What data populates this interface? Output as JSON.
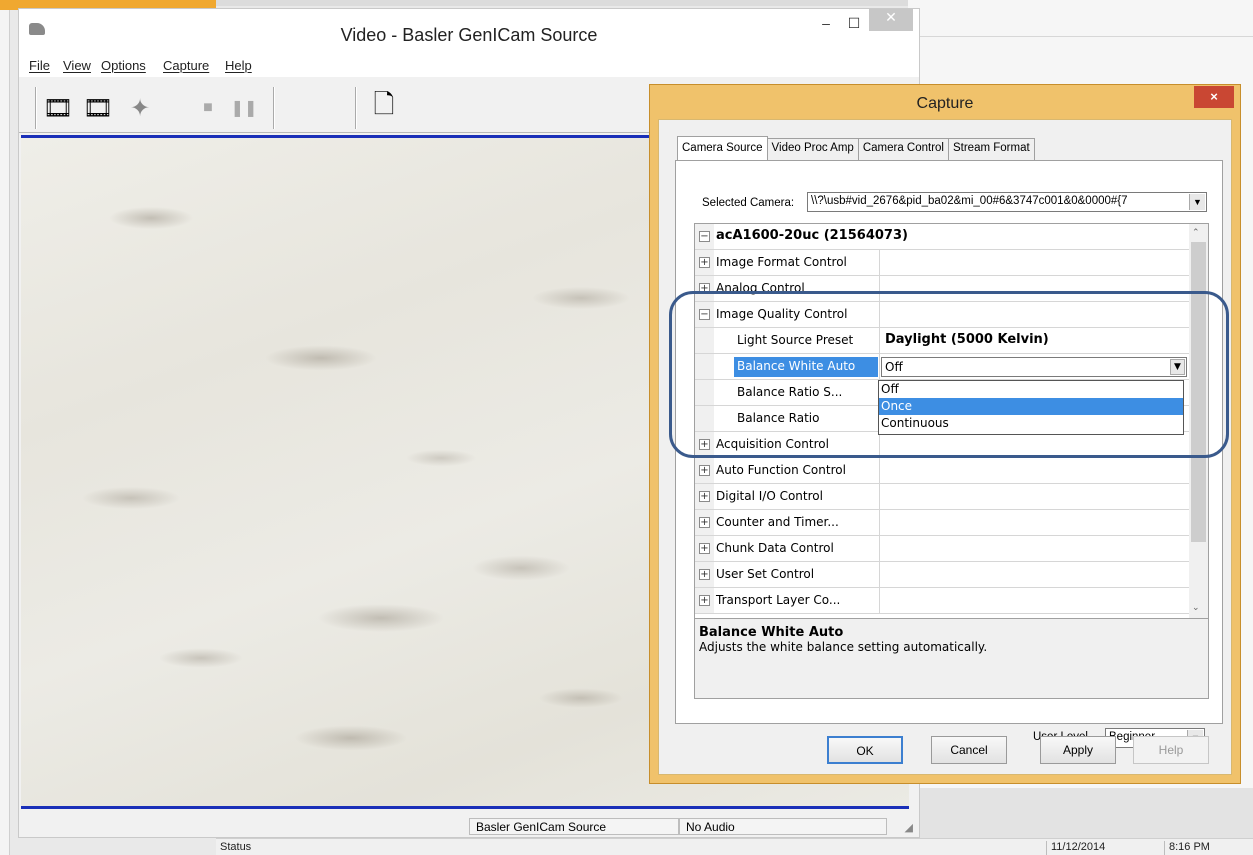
{
  "video_window": {
    "title": "Video - Basler GenICam Source",
    "menu": [
      "File",
      "View",
      "Options",
      "Capture",
      "Help"
    ],
    "status_cells": [
      "Basler GenICam Source",
      "No Audio"
    ]
  },
  "capture_dialog": {
    "title": "Capture",
    "close_label": "×",
    "tabs": [
      "Camera Source",
      "Video Proc Amp",
      "Camera Control",
      "Stream Format"
    ],
    "selected_camera_label": "Selected Camera:",
    "selected_camera_value": "\\\\?\\usb#vid_2676&pid_ba02&mi_00#6&3747c001&0&0000#{7",
    "grid": {
      "root": "acA1600-20uc (21564073)",
      "rows": [
        {
          "name": "Image Format Control",
          "value": ""
        },
        {
          "name": "Analog Control",
          "value": ""
        },
        {
          "name": "Image Quality Control",
          "value": ""
        },
        {
          "name": "Light Source Preset",
          "value": "Daylight (5000 Kelvin)"
        },
        {
          "name": "Balance White Auto",
          "value": "Off"
        },
        {
          "name": "Balance Ratio S...",
          "value": ""
        },
        {
          "name": "Balance Ratio",
          "value": ""
        },
        {
          "name": "Acquisition Control",
          "value": ""
        },
        {
          "name": "Auto Function Control",
          "value": ""
        },
        {
          "name": "Digital I/O Control",
          "value": ""
        },
        {
          "name": "Counter and Timer...",
          "value": ""
        },
        {
          "name": "Chunk Data Control",
          "value": ""
        },
        {
          "name": "User Set Control",
          "value": ""
        },
        {
          "name": "Transport Layer Co...",
          "value": ""
        }
      ],
      "dropdown_options": [
        "Off",
        "Once",
        "Continuous"
      ],
      "dropdown_highlighted": "Once"
    },
    "description": {
      "title": "Balance White Auto",
      "text": "Adjusts the white balance setting automatically."
    },
    "user_level_label": "User Level",
    "user_level_value": "Beginner",
    "buttons": {
      "ok": "OK",
      "cancel": "Cancel",
      "apply": "Apply",
      "help": "Help"
    }
  },
  "background": {
    "status_label": "Status",
    "date": "11/12/2014",
    "time": "8:16 PM"
  },
  "colors": {
    "dialog_frame": "#f0c26b",
    "selection": "#3d8ee3",
    "video_border": "#1a2fb8",
    "highlight_ring": "#3a5a8c"
  }
}
